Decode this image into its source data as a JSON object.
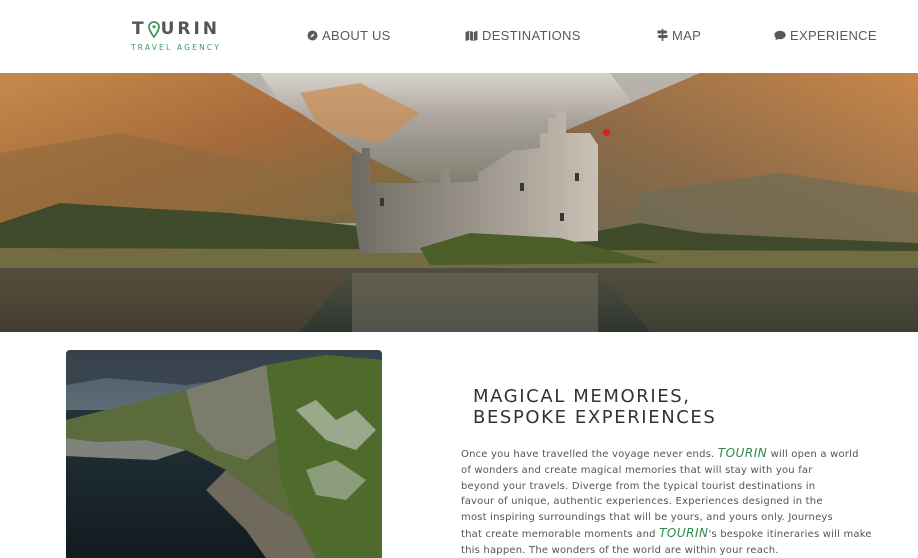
{
  "header": {
    "logo": {
      "word_before": "T",
      "word_after": "URIN",
      "tagline": "TRAVEL AGENCY",
      "pin_color": "#3d9a57"
    },
    "nav": [
      {
        "label": "ABOUT US",
        "icon": "compass-icon"
      },
      {
        "label": "DESTINATIONS",
        "icon": "map-icon"
      },
      {
        "label": "MAP",
        "icon": "signpost-icon"
      },
      {
        "label": "EXPERIENCE",
        "icon": "chat-bubble-icon"
      }
    ]
  },
  "hero": {
    "image": "castle-on-lake-with-mountains"
  },
  "content": {
    "side_image": "sea-cliffs-coastline",
    "headline_lines": [
      "MAGICAL MEMORIES,",
      "BESPOKE EXPERIENCES"
    ],
    "brand_name": "TOURIN",
    "brand_color": "#2e8a4a",
    "paragraph": {
      "l1_a": "Once you have travelled the voyage never ends.",
      "l1_b": "will open a world",
      "l2": "of wonders and create magical memories that will stay with you far",
      "l3": "beyond your travels. Diverge from the typical tourist destinations in",
      "l4": "favour of unique, authentic experiences. Experiences designed in the",
      "l5": "most inspiring surroundings that will be yours, and yours only. Journeys",
      "l6_a": "that create memorable moments and",
      "l6_b": "'s bespoke itineraries will make",
      "l7": "this happen. The wonders of the world are within your reach."
    }
  }
}
